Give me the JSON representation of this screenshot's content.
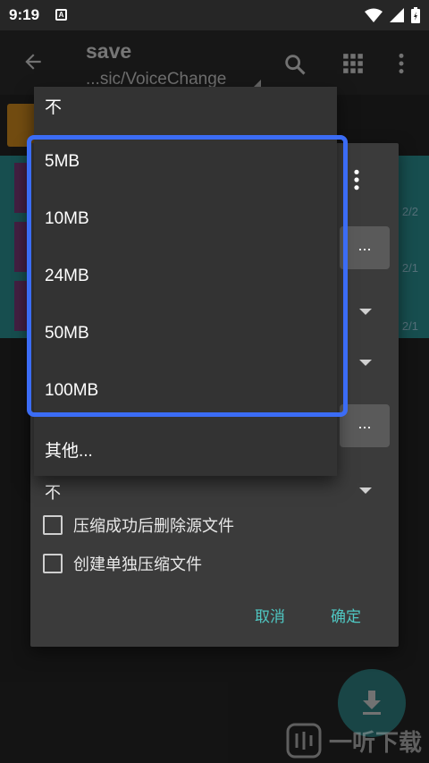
{
  "status_bar": {
    "time": "9:19",
    "notif_icon": "A"
  },
  "app_bar": {
    "title": "save",
    "subtitle": "...sic/VoiceChange"
  },
  "list": {
    "tags": [
      "2/2",
      "2/1",
      "2/1"
    ]
  },
  "dialog": {
    "dots_label": "...",
    "select_value": "不",
    "checkboxes": [
      {
        "label": "压缩成功后删除源文件",
        "checked": false
      },
      {
        "label": "创建单独压缩文件",
        "checked": false
      }
    ],
    "cancel_label": "取消",
    "ok_label": "确定"
  },
  "dropdown": {
    "options": [
      "不",
      "5MB",
      "10MB",
      "24MB",
      "50MB",
      "100MB",
      "其他..."
    ]
  },
  "watermark": {
    "text": "一听下载"
  },
  "colors": {
    "accent": "#4fc7c2",
    "highlight_border": "#3b6cf5",
    "teal": "#2b8f90"
  }
}
